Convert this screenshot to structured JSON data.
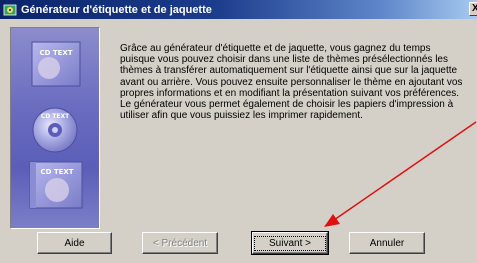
{
  "window": {
    "title": "Générateur d'étiquette et de jaquette",
    "close_label": "X"
  },
  "panel": {
    "cd_labels": [
      "CD TEXT",
      "CD TEXT",
      "CD TEXT"
    ]
  },
  "description": "Grâce au générateur d'étiquette et de jaquette, vous gagnez du temps puisque vous pouvez choisir dans une liste de thèmes présélectionnés les thèmes à transférer automatiquement sur l'étiquette ainsi que sur la jaquette avant ou arrière. Vous pouvez ensuite personnaliser le thème en ajoutant vos propres informations et en modifiant la présentation suivant vos préférences. Le générateur vous permet également de choisir les papiers d'impression à utiliser afin que vous puissiez les imprimer rapidement.",
  "buttons": {
    "help": "Aide",
    "previous": "< Précédent",
    "next": "Suivant >",
    "cancel": "Annuler"
  },
  "colors": {
    "titlebar_start": "#0a246a",
    "titlebar_end": "#a6caf0",
    "dialog_face": "#d4d0c8",
    "annotation_arrow": "#e01010"
  }
}
